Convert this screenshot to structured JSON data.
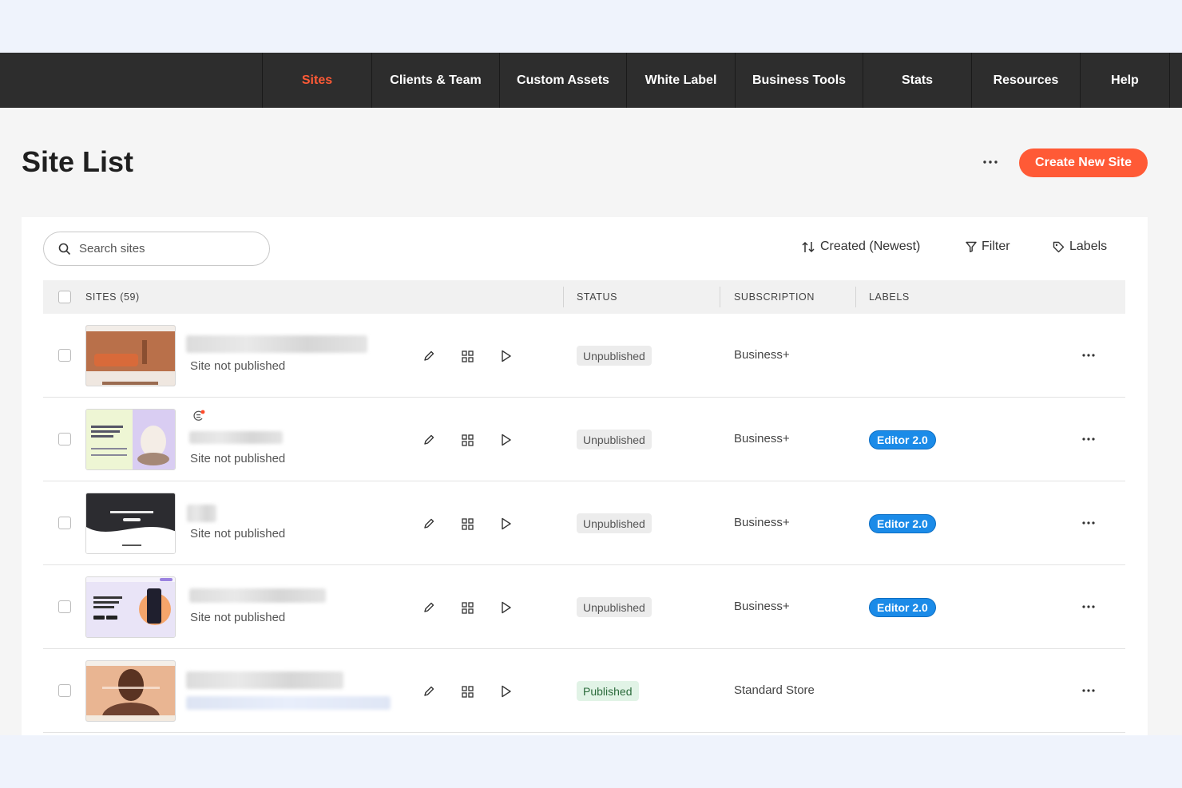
{
  "nav": {
    "items": [
      {
        "label": "Sites",
        "active": true
      },
      {
        "label": "Clients & Team"
      },
      {
        "label": "Custom Assets"
      },
      {
        "label": "White Label"
      },
      {
        "label": "Business Tools"
      },
      {
        "label": "Stats"
      },
      {
        "label": "Resources"
      },
      {
        "label": "Help"
      }
    ],
    "accent": "#ff5a36",
    "background": "#2d2d2d"
  },
  "header": {
    "title": "Site List",
    "more_icon": "more-horizontal-icon",
    "create_label": "Create New Site"
  },
  "toolbar": {
    "search_placeholder": "Search sites",
    "sort_label": "Created (Newest)",
    "filter_label": "Filter",
    "labels_label": "Labels"
  },
  "table": {
    "columns": {
      "sites": "SITES (59)",
      "status": "STATUS",
      "subscription": "SUBSCRIPTION",
      "labels": "LABELS"
    },
    "rows": [
      {
        "subtext": "Site not published",
        "status": "Unpublished",
        "subscription": "Business+",
        "label": ""
      },
      {
        "subtext": "Site not published",
        "status": "Unpublished",
        "subscription": "Business+",
        "label": "Editor 2.0"
      },
      {
        "subtext": "Site not published",
        "status": "Unpublished",
        "subscription": "Business+",
        "label": "Editor 2.0"
      },
      {
        "subtext": "Site not published",
        "status": "Unpublished",
        "subscription": "Business+",
        "label": "Editor 2.0"
      },
      {
        "subtext": "",
        "status": "Published",
        "subscription": "Standard Store",
        "label": ""
      }
    ]
  },
  "colors": {
    "published_bg": "#e1f3e6",
    "unpublished_bg": "#ececec",
    "label_blue": "#1b8be8"
  }
}
